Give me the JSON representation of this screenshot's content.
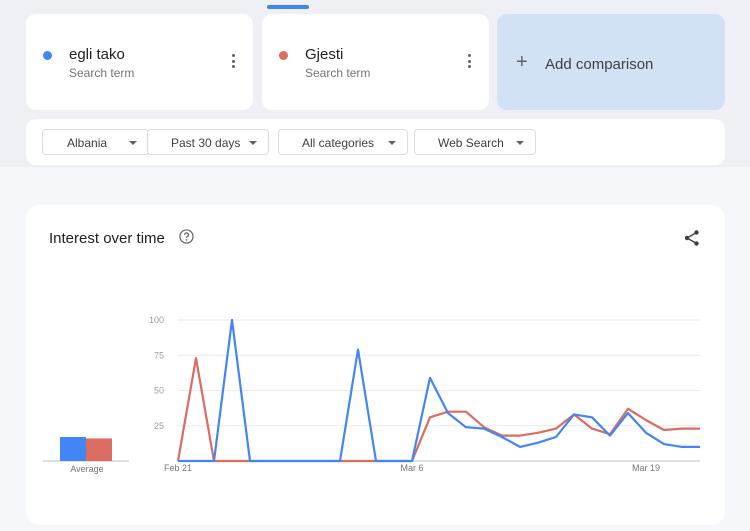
{
  "terms": [
    {
      "name": "egli tako",
      "subtitle": "Search term",
      "color": "#4285f4"
    },
    {
      "name": "Gjesti",
      "subtitle": "Search term",
      "color": "#db6c62"
    }
  ],
  "add_comparison": {
    "label": "Add comparison"
  },
  "filters": {
    "region": "Albania",
    "time": "Past 30 days",
    "category": "All categories",
    "property": "Web Search"
  },
  "chart": {
    "title": "Interest over time",
    "average_label": "Average"
  },
  "chart_data": {
    "type": "line",
    "ylim": [
      0,
      100
    ],
    "y_ticks": [
      25,
      50,
      75,
      100
    ],
    "x": [
      "Feb 21",
      "Feb 22",
      "Feb 23",
      "Feb 24",
      "Feb 25",
      "Feb 26",
      "Feb 27",
      "Feb 28",
      "Mar 1",
      "Mar 2",
      "Mar 3",
      "Mar 4",
      "Mar 5",
      "Mar 6",
      "Mar 7",
      "Mar 8",
      "Mar 9",
      "Mar 10",
      "Mar 11",
      "Mar 12",
      "Mar 13",
      "Mar 14",
      "Mar 15",
      "Mar 16",
      "Mar 17",
      "Mar 18",
      "Mar 19",
      "Mar 20",
      "Mar 21",
      "Mar 22"
    ],
    "x_tick_labels": [
      "Feb 21",
      "Mar 6",
      "Mar 19"
    ],
    "grid": true,
    "series": [
      {
        "name": "egli tako",
        "color": "#4285f4",
        "values": [
          0,
          0,
          0,
          100,
          0,
          0,
          0,
          0,
          0,
          0,
          79,
          0,
          0,
          0,
          59,
          34,
          24,
          23,
          17,
          10,
          13,
          17,
          33,
          31,
          18,
          34,
          20,
          12,
          10,
          10
        ],
        "average": 17
      },
      {
        "name": "Gjesti",
        "color": "#db6c62",
        "values": [
          0,
          73,
          0,
          0,
          0,
          0,
          0,
          0,
          0,
          0,
          0,
          0,
          0,
          0,
          31,
          35,
          35,
          24,
          18,
          18,
          20,
          23,
          33,
          23,
          19,
          37,
          29,
          22,
          23,
          23
        ],
        "average": 16
      }
    ]
  }
}
